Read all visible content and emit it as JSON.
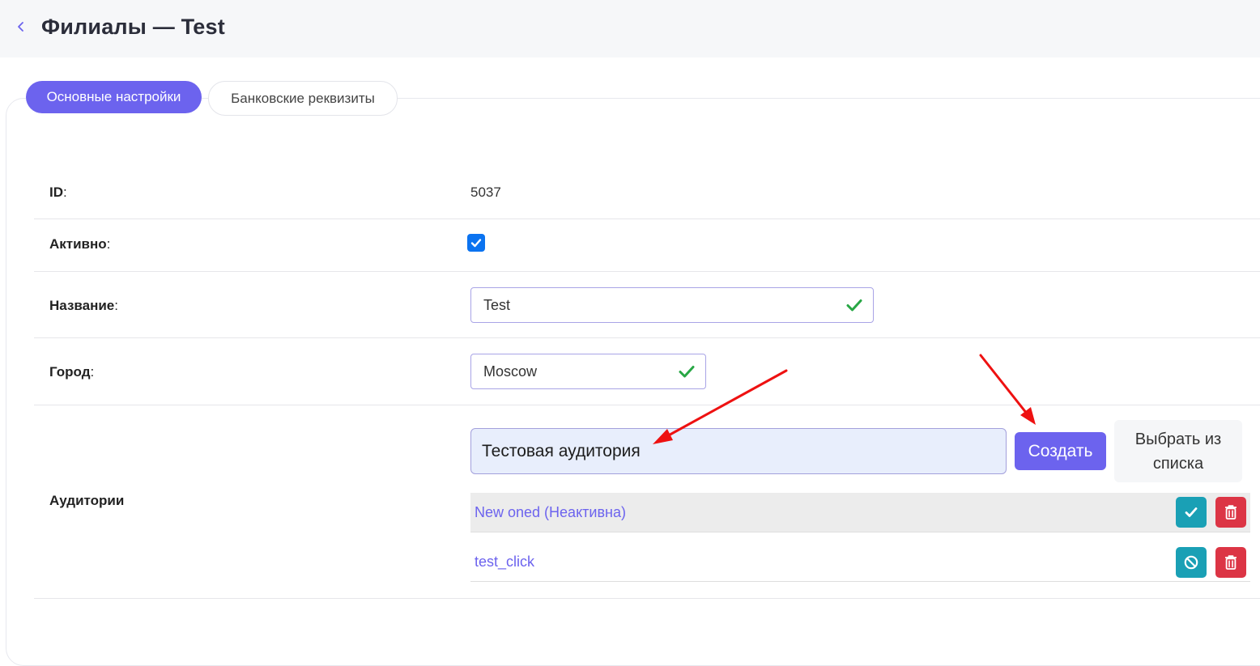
{
  "header": {
    "title": "Филиалы — Test",
    "back_icon": "chevron-left-icon"
  },
  "tabs": [
    {
      "label": "Основные настройки",
      "active": true
    },
    {
      "label": "Банковские реквизиты",
      "active": false
    }
  ],
  "form": {
    "id": {
      "label": "ID",
      "colon": ":",
      "value": "5037"
    },
    "active": {
      "label": "Активно",
      "colon": ":",
      "checked": true
    },
    "name": {
      "label": "Название",
      "colon": ":",
      "value": "Test"
    },
    "city": {
      "label": "Город",
      "colon": ":",
      "value": "Moscow"
    },
    "audiences": {
      "label": "Аудитории",
      "new_value": "Тестовая аудитория",
      "create_label": "Создать",
      "choose_label": "Выбрать из списка",
      "items": [
        {
          "name": "New oned (Неактивна)",
          "toggle_icon": "check-icon",
          "delete_icon": "trash-icon"
        },
        {
          "name": "test_click",
          "toggle_icon": "ban-icon",
          "delete_icon": "trash-icon"
        }
      ]
    }
  },
  "colors": {
    "accent": "#6c63ee",
    "valid": "#28a745",
    "teal": "#1aa0b5",
    "danger": "#dc3545",
    "annotation_arrow": "#ee1111"
  }
}
